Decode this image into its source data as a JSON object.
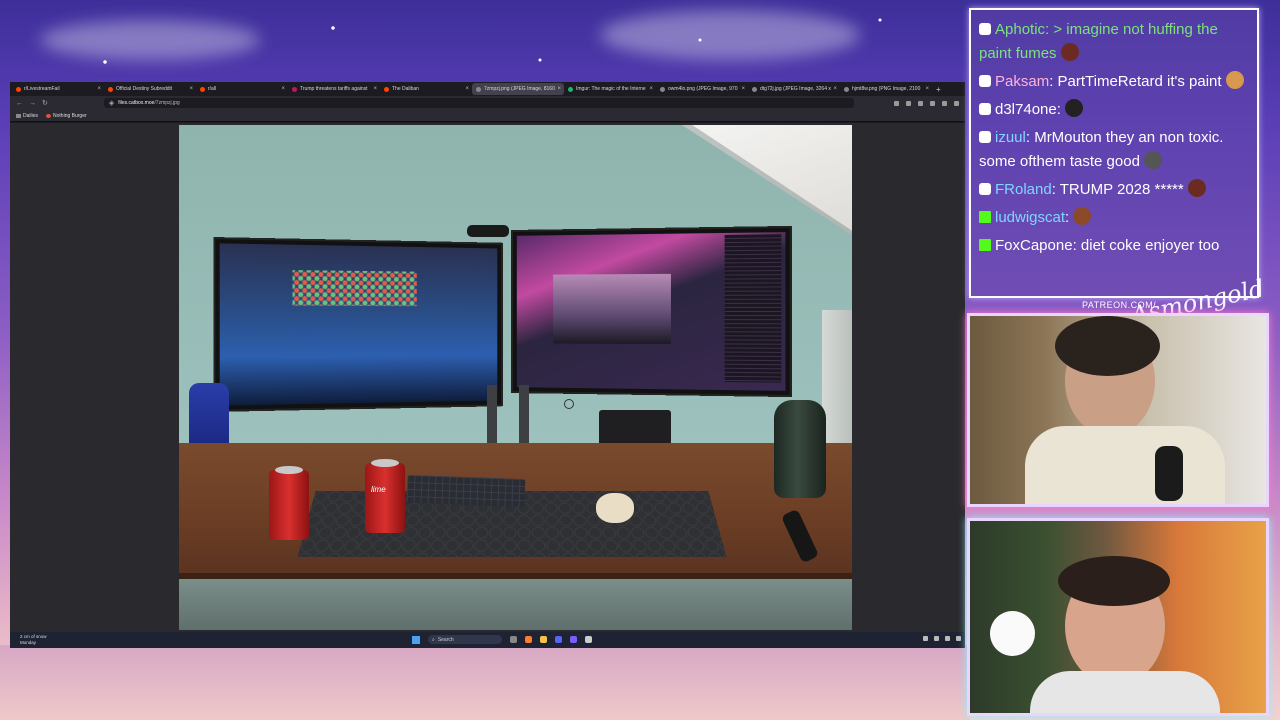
{
  "browser": {
    "tabs": [
      {
        "label": "r/LivestreamFail",
        "favicon_color": "#ff4500",
        "active": false
      },
      {
        "label": "Official Destiny Subreddit",
        "favicon_color": "#ff4500",
        "active": false
      },
      {
        "label": "r/all",
        "favicon_color": "#ff4500",
        "active": false
      },
      {
        "label": "Trump threatens tariffs against",
        "favicon_color": "#c2185b",
        "active": false
      },
      {
        "label": "The Daliban",
        "favicon_color": "#ff4500",
        "active": false
      },
      {
        "label": "7zmpzj.png (JPEG Image, 8160",
        "favicon_color": "#888888",
        "active": true
      },
      {
        "label": "Imgur: The magic of the Interne",
        "favicon_color": "#1bb76e",
        "active": false
      },
      {
        "label": "owm4lo.png (JPEG Image, 970",
        "favicon_color": "#888888",
        "active": false
      },
      {
        "label": "dtg72j.jpg (JPEG Image, 3264 x",
        "favicon_color": "#888888",
        "active": false
      },
      {
        "label": "hjmt8w.png (PNG Image, 2100",
        "favicon_color": "#888888",
        "active": false
      }
    ],
    "new_tab": "+",
    "url_domain": "files.catbox.moe",
    "url_path": "/7zmpzj.jpg",
    "bookmarks": [
      "Dailies",
      "Nothing Burger"
    ]
  },
  "photo": {
    "can_label_1": "",
    "can_label_2": "lime"
  },
  "taskbar": {
    "weather_line1": "2 cm of snow",
    "weather_line2": "Monday",
    "search_label": "Search"
  },
  "chat": {
    "messages": [
      {
        "user": "Aphotic",
        "user_color": "#7be27b",
        "badge": "mod",
        "text": ": > imagine not huffing the paint fumes",
        "text_color": "#7be27b",
        "emote": "#6b2b22"
      },
      {
        "user": "Paksam",
        "user_color": "#ffb3d6",
        "badge": "mod",
        "text": ": PartTimeRetard it's paint",
        "text_color": "#ffffff",
        "emote": "#d89850"
      },
      {
        "user": "d3l74one",
        "user_color": "#ffffff",
        "badge": "mod",
        "text": ":",
        "text_color": "#ffffff",
        "emote": "#222222"
      },
      {
        "user": "izuul",
        "user_color": "#7fd6ff",
        "badge": "mod",
        "text": ": MrMouton they an non toxic. some ofthem taste good",
        "text_color": "#ffffff",
        "emote": "#555555"
      },
      {
        "user": "FRoland",
        "user_color": "#7fd6ff",
        "badge": "mod",
        "text": ": TRUMP 2028 *****",
        "text_color": "#ffffff",
        "emote": "#6b2b22"
      },
      {
        "user": "ludwigscat",
        "user_color": "#7fd6ff",
        "badge": "k",
        "text": ":",
        "text_color": "#ffffff",
        "emote": "#8a4a2a"
      },
      {
        "user": "FoxCapone",
        "user_color": "#ffffff",
        "badge": "k",
        "text": ": diet coke enjoyer too",
        "text_color": "#ffffff",
        "emote": ""
      }
    ]
  },
  "overlay": {
    "patreon": "PATREON.COM/",
    "signature": "Asmongold"
  }
}
